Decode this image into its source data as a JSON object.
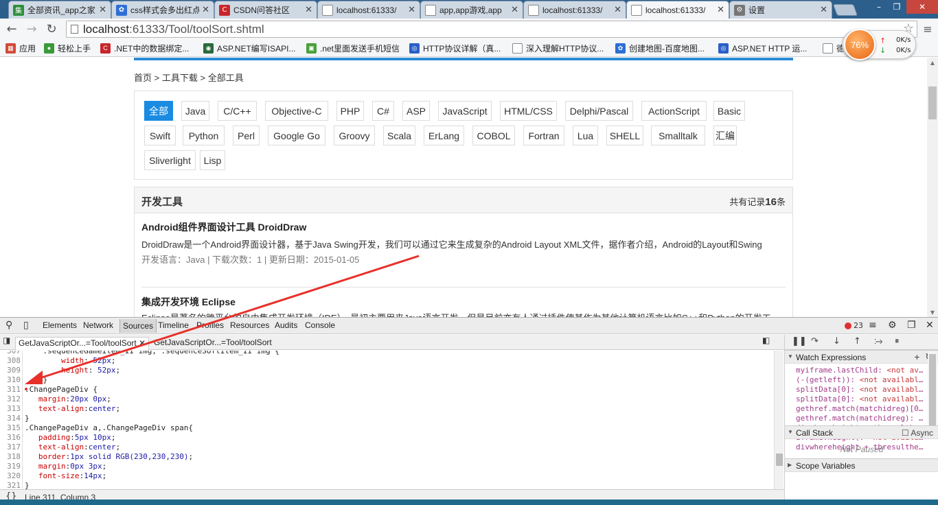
{
  "browser": {
    "tabs": [
      {
        "title": "全部资讯_app之家",
        "fav_color": "#2f8f3a",
        "fav_glyph": "集",
        "icon": "app-home-icon"
      },
      {
        "title": "css样式会多出红点",
        "fav_color": "#2e6fd6",
        "fav_glyph": "✿",
        "icon": "baidu-paw-icon"
      },
      {
        "title": "CSDN问答社区",
        "fav_color": "#c8262b",
        "fav_glyph": "C",
        "icon": "csdn-icon"
      },
      {
        "title": "localhost:61333/",
        "fav_color": "#ffffff",
        "fav_glyph": "",
        "icon": "page-icon"
      },
      {
        "title": "app,app游戏,app",
        "fav_color": "#ffffff",
        "fav_glyph": "",
        "icon": "page-icon"
      },
      {
        "title": "localhost:61333/",
        "fav_color": "#ffffff",
        "fav_glyph": "",
        "icon": "page-icon"
      },
      {
        "title": "localhost:61333/",
        "fav_color": "#ffffff",
        "fav_glyph": "",
        "icon": "page-icon",
        "active": true
      },
      {
        "title": "设置",
        "fav_color": "#777777",
        "fav_glyph": "⚙",
        "icon": "settings-gear-icon"
      }
    ],
    "url_host": "localhost",
    "url_rest": ":61333/Tool/toolSort.shtml",
    "bookmarks": [
      {
        "label": "应用",
        "icon": "apps-grid-icon",
        "color": "#d24a3a",
        "glyph": "▦"
      },
      {
        "label": "轻松上手",
        "icon": "chrome-icon",
        "color": "#3a9a3a",
        "glyph": "●"
      },
      {
        "label": ".NET中的数据绑定...",
        "icon": "csdn-icon",
        "color": "#c8262b",
        "glyph": "C"
      },
      {
        "label": "ASP.NET编写ISAPI...",
        "icon": "globe-icon",
        "color": "#2a6a3a",
        "glyph": "◉"
      },
      {
        "label": ".net里面发送手机短信",
        "icon": "bookmark-icon",
        "color": "#4aa03a",
        "glyph": "▣"
      },
      {
        "label": "HTTP协议详解（真...",
        "icon": "blog-icon",
        "color": "#2a5fc8",
        "glyph": "◎"
      },
      {
        "label": "深入理解HTTP协议...",
        "icon": "page-icon",
        "color": "#ffffff",
        "glyph": ""
      },
      {
        "label": "创建地图-百度地图...",
        "icon": "baidu-paw-icon",
        "color": "#2e6fd6",
        "glyph": "✿"
      },
      {
        "label": "ASP.NET HTTP 运...",
        "icon": "blog-icon",
        "color": "#2a5fc8",
        "glyph": "◎"
      },
      {
        "label": "德",
        "icon": "page-icon",
        "color": "#ffffff",
        "glyph": ""
      }
    ],
    "meter": {
      "percent": "76%",
      "up_speed": "0K/s",
      "down_speed": "0K/s"
    }
  },
  "page": {
    "breadcrumb": [
      "首页",
      "工具下载",
      "全部工具"
    ],
    "breadcrumb_sep": " > ",
    "filters_row1": [
      "全部",
      "Java",
      "C/C++",
      "Objective-C",
      "PHP",
      "C#",
      "ASP",
      "JavaScript",
      "HTML/CSS",
      "Delphi/Pascal",
      "ActionScript",
      "Basic"
    ],
    "filters_row2": [
      "Swift",
      "Python",
      "Perl",
      "Google Go",
      "Groovy",
      "Scala",
      "ErLang",
      "COBOL",
      "Fortran",
      "Lua",
      "SHELL",
      "Smalltalk",
      "汇编"
    ],
    "filters_row3": [
      "Sliverlight",
      "Lisp"
    ],
    "list_title": "开发工具",
    "count_prefix": "共有记录",
    "count_value": "16",
    "count_suffix": "条",
    "items": [
      {
        "title": "Android组件界面设计工具 DroidDraw",
        "desc": "DroidDraw是一个Android界面设计器，基于Java Swing开发，我们可以通过它来生成复杂的Android Layout XML文件，据作者介绍，Android的Layout和Swing",
        "meta": "开发语言：Java | 下载次数：1 | 更新日期：2015-01-05"
      },
      {
        "title": "集成开发环境 Eclipse",
        "desc": "Eclipse是著名的跨平台的自由集成开发环境（IDE）。最初主要用来Java语言开发，但是目前亦有人通过插件使其作为其他计算机语言比如C++和Python的开发工",
        "meta": ""
      }
    ]
  },
  "devtools": {
    "tabs": [
      "Elements",
      "Network",
      "Sources",
      "Timeline",
      "Profiles",
      "Resources",
      "Audits",
      "Console"
    ],
    "selected_tab": "Sources",
    "error_count": "23",
    "file_tabs": [
      "GetJavaScriptOr...=Tool/toolSort",
      "GetJavaScriptOr...=Tool/toolSort"
    ],
    "code_lines": [
      {
        "n": "307",
        "segs": [
          [
            "t",
            "    .sequenceGameItem_II img, .sequenceSoftItem_II img {"
          ]
        ]
      },
      {
        "n": "308",
        "segs": [
          [
            "t",
            "        "
          ],
          [
            "p",
            "width"
          ],
          [
            "t",
            ": "
          ],
          [
            "v",
            "52px"
          ],
          [
            "t",
            ";"
          ]
        ]
      },
      {
        "n": "309",
        "segs": [
          [
            "t",
            "        "
          ],
          [
            "p",
            "height"
          ],
          [
            "t",
            ": "
          ],
          [
            "v",
            "52px"
          ],
          [
            "t",
            ";"
          ]
        ]
      },
      {
        "n": "310",
        "segs": [
          [
            "t",
            "    }"
          ]
        ]
      },
      {
        "n": "311",
        "segs": [
          [
            "t",
            ".ChangePageDiv {"
          ]
        ]
      },
      {
        "n": "312",
        "segs": [
          [
            "t",
            "   "
          ],
          [
            "p",
            "margin"
          ],
          [
            "t",
            ":"
          ],
          [
            "v",
            "20px 0px"
          ],
          [
            "t",
            ";"
          ]
        ]
      },
      {
        "n": "313",
        "segs": [
          [
            "t",
            "   "
          ],
          [
            "p",
            "text-align"
          ],
          [
            "t",
            ":"
          ],
          [
            "v",
            "center"
          ],
          [
            "t",
            ";"
          ]
        ]
      },
      {
        "n": "314",
        "segs": [
          [
            "t",
            "}"
          ]
        ]
      },
      {
        "n": "315",
        "segs": [
          [
            "t",
            ".ChangePageDiv a,.ChangePageDiv span{"
          ]
        ]
      },
      {
        "n": "316",
        "segs": [
          [
            "t",
            "   "
          ],
          [
            "p",
            "padding"
          ],
          [
            "t",
            ":"
          ],
          [
            "v",
            "5px 10px"
          ],
          [
            "t",
            ";"
          ]
        ]
      },
      {
        "n": "317",
        "segs": [
          [
            "t",
            "   "
          ],
          [
            "p",
            "text-align"
          ],
          [
            "t",
            ":"
          ],
          [
            "v",
            "center"
          ],
          [
            "t",
            ";"
          ]
        ]
      },
      {
        "n": "318",
        "segs": [
          [
            "t",
            "   "
          ],
          [
            "p",
            "border"
          ],
          [
            "t",
            ":"
          ],
          [
            "v",
            "1px solid RGB(230,230,230)"
          ],
          [
            "t",
            ";"
          ]
        ]
      },
      {
        "n": "319",
        "segs": [
          [
            "t",
            "   "
          ],
          [
            "p",
            "margin"
          ],
          [
            "t",
            ":"
          ],
          [
            "v",
            "0px 3px"
          ],
          [
            "t",
            ";"
          ]
        ]
      },
      {
        "n": "320",
        "segs": [
          [
            "t",
            "   "
          ],
          [
            "p",
            "font-size"
          ],
          [
            "t",
            ":"
          ],
          [
            "v",
            "14px"
          ],
          [
            "t",
            ";"
          ]
        ]
      },
      {
        "n": "321",
        "segs": [
          [
            "t",
            "}"
          ]
        ]
      }
    ],
    "status": "Line 311, Column 3",
    "watch_title": "Watch Expressions",
    "watches": [
      [
        "myiframe.lastChild: ",
        "<not av..."
      ],
      [
        "(-(getleft)): ",
        "<not availabl..."
      ],
      [
        "splitData[0]: ",
        "<not availabl..."
      ],
      [
        "splitData[0]: ",
        "<not availabl..."
      ],
      [
        "gethref.match(matchidreg)[0...",
        ""
      ],
      [
        "gethref.match(matchidreg): ",
        "..."
      ],
      [
        "divwhereheight + tbresulthe...",
        ""
      ],
      [
        "iframe.height(: ",
        "<not availa..."
      ],
      [
        "divwhereheight + tbresulthe...",
        ""
      ]
    ],
    "callstack_title": "Call Stack",
    "async_label": "Async",
    "not_paused": "Not Paused",
    "scope_title": "Scope Variables"
  }
}
